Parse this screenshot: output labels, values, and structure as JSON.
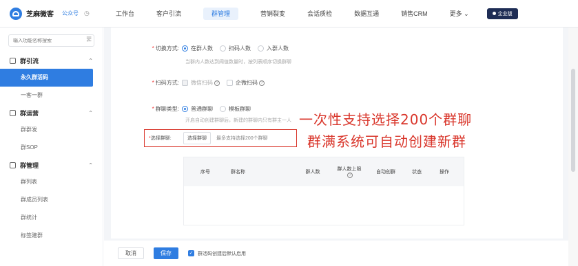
{
  "brand": {
    "name": "芝麻微客",
    "tag": "公众号",
    "clock_icon": "clock-icon"
  },
  "nav": {
    "items": [
      {
        "label": "工作台",
        "active": false
      },
      {
        "label": "客户引流",
        "active": false
      },
      {
        "label": "群管理",
        "active": true
      },
      {
        "label": "营销裂变",
        "active": false
      },
      {
        "label": "会话质检",
        "active": false
      },
      {
        "label": "数据互通",
        "active": false
      },
      {
        "label": "销售CRM",
        "active": false
      },
      {
        "label": "更多",
        "active": false
      }
    ],
    "more_caret": "⌄",
    "enterprise_label": "企业版"
  },
  "sidebar": {
    "search_placeholder": "输入功能名称搜索",
    "groups": [
      {
        "label": "群引流",
        "items": [
          {
            "label": "永久群活码",
            "active": true
          },
          {
            "label": "一客一群",
            "active": false
          }
        ]
      },
      {
        "label": "群运营",
        "items": [
          {
            "label": "群群发",
            "active": false
          },
          {
            "label": "群SOP",
            "active": false
          }
        ]
      },
      {
        "label": "群管理",
        "items": [
          {
            "label": "群列表",
            "active": false
          },
          {
            "label": "群成员列表",
            "active": false
          },
          {
            "label": "群统计",
            "active": false
          },
          {
            "label": "标签建群",
            "active": false
          }
        ]
      }
    ]
  },
  "form": {
    "switch_label": "切换方式:",
    "switch_options": [
      "在群人数",
      "扫码人数",
      "入群人数"
    ],
    "switch_hint": "当群内人数达到阈值数量时，按列表顺序切换群聊",
    "scan_label": "扫码方式:",
    "scan_options": [
      "微信扫码",
      "企微扫码"
    ],
    "type_label": "群聊类型:",
    "type_options": [
      "普通群聊",
      "模板群聊"
    ],
    "type_hint": "开启自动创建群聊后，新建的群聊内只有群主一人",
    "select_label": "选择群聊:",
    "select_button": "选择群聊",
    "select_note": "最多支持选择200个群聊"
  },
  "table": {
    "headers": [
      "序号",
      "群名称",
      "群人数",
      "群人数上限",
      "自动创群",
      "状态",
      "操作"
    ]
  },
  "annotation": {
    "line1": "一次性支持选择200个群聊",
    "line2": "群满系统可自动创建新群",
    "color": "#d9362b"
  },
  "footer": {
    "cancel_label": "取消",
    "save_label": "保存",
    "checkbox_label": "群活码创建后默认启用"
  },
  "colors": {
    "accent": "#2f7de1",
    "annotation_red": "#d9362b",
    "enterprise_bg": "#1e2d55"
  }
}
